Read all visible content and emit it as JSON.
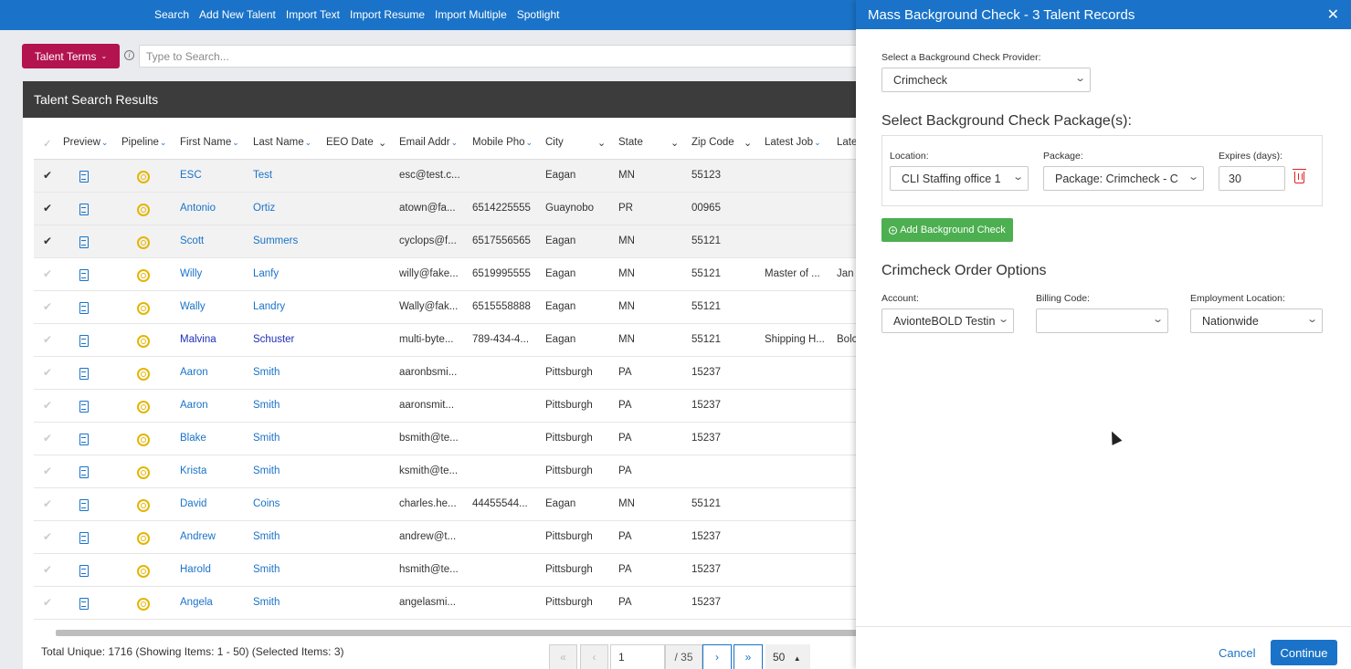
{
  "topnav": {
    "links": [
      "Search",
      "Add New Talent",
      "Import Text",
      "Import Resume",
      "Import Multiple",
      "Spotlight"
    ]
  },
  "search": {
    "terms_label": "Talent Terms",
    "info_glyph": "i",
    "placeholder": "Type to Search..."
  },
  "results": {
    "title": "Talent Search Results",
    "columns": [
      "Preview",
      "Pipeline",
      "First Name",
      "Last Name",
      "EEO Date",
      "Email Addr",
      "Mobile Pho",
      "City",
      "State",
      "Zip Code",
      "Latest Job",
      "Late"
    ],
    "rows": [
      {
        "selected": true,
        "first": "ESC",
        "last": "Test",
        "email": "esc@test.c...",
        "phone": "",
        "city": "Eagan",
        "state": "MN",
        "zip": "55123",
        "job": "",
        "late": ""
      },
      {
        "selected": true,
        "first": "Antonio",
        "last": "Ortiz",
        "email": "atown@fa...",
        "phone": "6514225555",
        "city": "Guaynobo",
        "state": "PR",
        "zip": "00965",
        "job": "",
        "late": ""
      },
      {
        "selected": true,
        "first": "Scott",
        "last": "Summers",
        "email": "cyclops@f...",
        "phone": "6517556565",
        "city": "Eagan",
        "state": "MN",
        "zip": "55121",
        "job": "",
        "late": ""
      },
      {
        "selected": false,
        "first": "Willy",
        "last": "Lanfy",
        "email": "willy@fake...",
        "phone": "6519995555",
        "city": "Eagan",
        "state": "MN",
        "zip": "55121",
        "job": "Master of ...",
        "late": "Jan"
      },
      {
        "selected": false,
        "first": "Wally",
        "last": "Landry",
        "email": "Wally@fak...",
        "phone": "6515558888",
        "city": "Eagan",
        "state": "MN",
        "zip": "55121",
        "job": "",
        "late": ""
      },
      {
        "selected": false,
        "first": "Malvina",
        "last": "Schuster",
        "email": "multi-byte...",
        "phone": "789-434-4...",
        "city": "Eagan",
        "state": "MN",
        "zip": "55121",
        "job": "Shipping H...",
        "late": "Bolc",
        "dark": true
      },
      {
        "selected": false,
        "first": "Aaron",
        "last": "Smith",
        "email": "aaronbsmi...",
        "phone": "",
        "city": "Pittsburgh",
        "state": "PA",
        "zip": "15237",
        "job": "",
        "late": ""
      },
      {
        "selected": false,
        "first": "Aaron",
        "last": "Smith",
        "email": "aaronsmit...",
        "phone": "",
        "city": "Pittsburgh",
        "state": "PA",
        "zip": "15237",
        "job": "",
        "late": ""
      },
      {
        "selected": false,
        "first": "Blake",
        "last": "Smith",
        "email": "bsmith@te...",
        "phone": "",
        "city": "Pittsburgh",
        "state": "PA",
        "zip": "15237",
        "job": "",
        "late": ""
      },
      {
        "selected": false,
        "first": "Krista",
        "last": "Smith",
        "email": "ksmith@te...",
        "phone": "",
        "city": "Pittsburgh",
        "state": "PA",
        "zip": "",
        "job": "",
        "late": ""
      },
      {
        "selected": false,
        "first": "David",
        "last": "Coins",
        "email": "charles.he...",
        "phone": "44455544...",
        "city": "Eagan",
        "state": "MN",
        "zip": "55121",
        "job": "",
        "late": ""
      },
      {
        "selected": false,
        "first": "Andrew",
        "last": "Smith",
        "email": "andrew@t...",
        "phone": "",
        "city": "Pittsburgh",
        "state": "PA",
        "zip": "15237",
        "job": "",
        "late": ""
      },
      {
        "selected": false,
        "first": "Harold",
        "last": "Smith",
        "email": "hsmith@te...",
        "phone": "",
        "city": "Pittsburgh",
        "state": "PA",
        "zip": "15237",
        "job": "",
        "late": ""
      },
      {
        "selected": false,
        "first": "Angela",
        "last": "Smith",
        "email": "angelasmi...",
        "phone": "",
        "city": "Pittsburgh",
        "state": "PA",
        "zip": "15237",
        "job": "",
        "late": ""
      }
    ],
    "footer": "Total Unique: 1716 (Showing Items: 1 - 50) (Selected Items: 3)"
  },
  "pager": {
    "first": "«",
    "prev": "‹",
    "page": "1",
    "of": "/ 35",
    "next": "›",
    "last": "»",
    "page_size": "50"
  },
  "drawer": {
    "title": "Mass Background Check - 3 Talent Records",
    "close": "✕",
    "provider_label": "Select a Background Check Provider:",
    "provider_value": "Crimcheck",
    "packages_heading": "Select Background Check Package(s):",
    "location_label": "Location:",
    "location_value": "CLI Staffing office 1",
    "package_label": "Package:",
    "package_value": "Package: Crimcheck - C",
    "expires_label": "Expires (days):",
    "expires_value": "30",
    "add_button": "Add Background Check",
    "order_heading": "Crimcheck Order Options",
    "account_label": "Account:",
    "account_value": "AvionteBOLD Testin",
    "billing_label": "Billing Code:",
    "billing_value": "",
    "employment_label": "Employment Location:",
    "employment_value": "Nationwide",
    "cancel": "Cancel",
    "continue": "Continue"
  },
  "colors": {
    "brand_blue": "#1a73c8",
    "terms_button": "#b3134f",
    "add_button": "#4caf50",
    "delete": "#e02020",
    "pipeline_icon": "#e3b505"
  }
}
